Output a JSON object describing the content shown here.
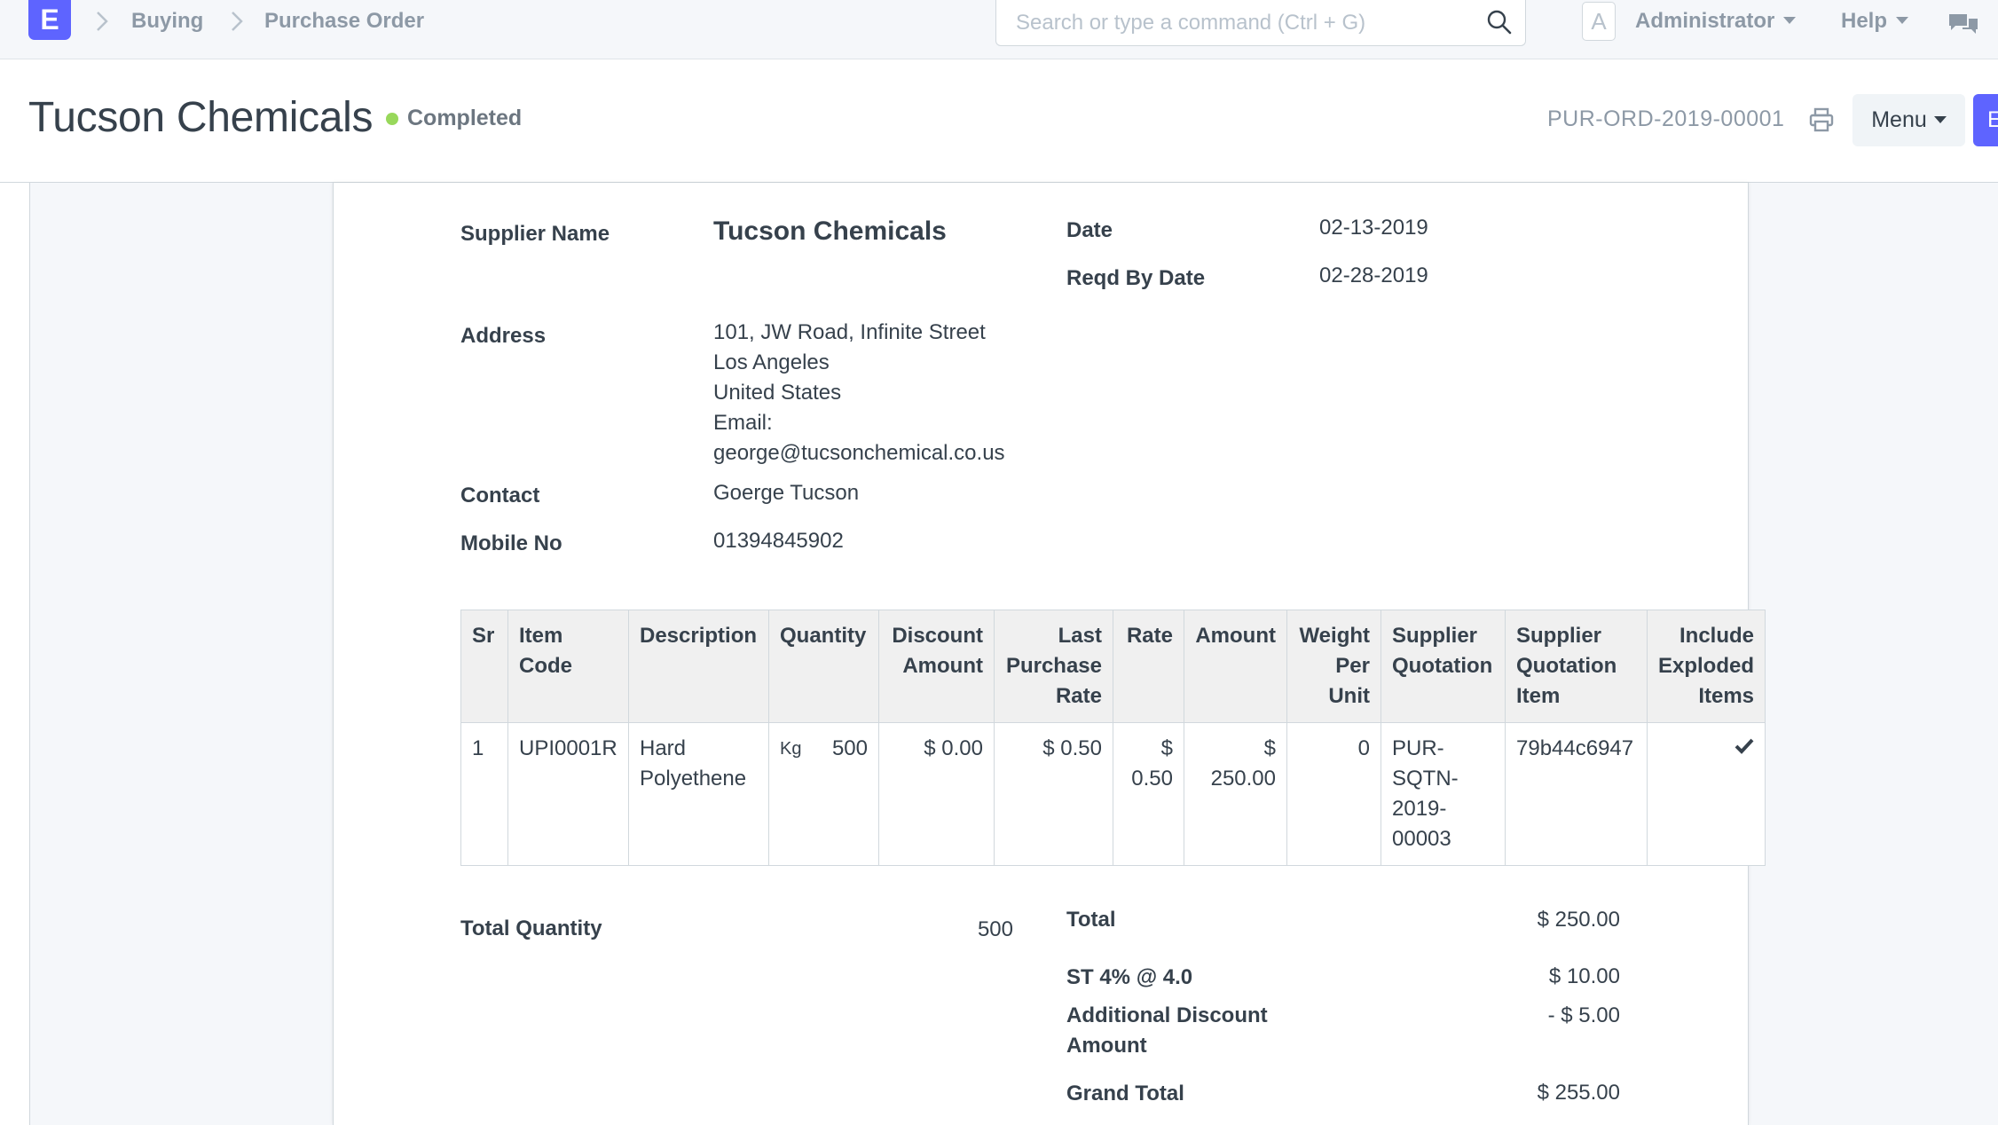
{
  "navbar": {
    "logo": "E",
    "breadcrumbs": [
      "Buying",
      "Purchase Order"
    ],
    "search_placeholder": "Search or type a command (Ctrl + G)",
    "avatar_letter": "A",
    "user_menu": "Administrator",
    "help_menu": "Help"
  },
  "page_head": {
    "title": "Tucson Chemicals",
    "status": "Completed",
    "status_color": "#98d85b",
    "doc_name": "PUR-ORD-2019-00001",
    "menu_label": "Menu",
    "primary_label": "E"
  },
  "details": {
    "supplier_label": "Supplier Name",
    "supplier": "Tucson Chemicals",
    "date_label": "Date",
    "date": "02-13-2019",
    "reqd_label": "Reqd By Date",
    "reqd_date": "02-28-2019",
    "address_label": "Address",
    "address_lines": [
      "101, JW Road, Infinite Street",
      "Los Angeles",
      "United States",
      "Email:",
      "george@tucsonchemical.co.us"
    ],
    "contact_label": "Contact",
    "contact": "Goerge Tucson",
    "mobile_label": "Mobile No",
    "mobile": "01394845902"
  },
  "items": {
    "headers": {
      "sr": "Sr",
      "item_code": "Item Code",
      "description": "Description",
      "quantity": "Quantity",
      "discount": "Discount Amount",
      "last_rate": "Last Purchase Rate",
      "rate": "Rate",
      "amount": "Amount",
      "weight": "Weight Per Unit",
      "sq": "Supplier Quotation",
      "sq_item": "Supplier Quotation Item",
      "exploded": "Include Exploded Items"
    },
    "rows": [
      {
        "sr": "1",
        "item_code": "UPI0001R",
        "description": "Hard Polyethene",
        "uom": "Kg",
        "qty": "500",
        "discount": "$ 0.00",
        "last_rate": "$ 0.50",
        "rate": "$ 0.50",
        "amount": "$ 250.00",
        "weight": "0",
        "sq": "PUR-SQTN-2019-00003",
        "sq_item": "79b44c6947",
        "exploded": true
      }
    ]
  },
  "totals": {
    "total_qty_label": "Total Quantity",
    "total_qty": "500",
    "total_label": "Total",
    "total": "$ 250.00",
    "tax_label": "ST 4% @ 4.0",
    "tax": "$ 10.00",
    "discount_label": "Additional Discount Amount",
    "discount": "- $ 5.00",
    "grand_label": "Grand Total",
    "grand": "$ 255.00"
  }
}
